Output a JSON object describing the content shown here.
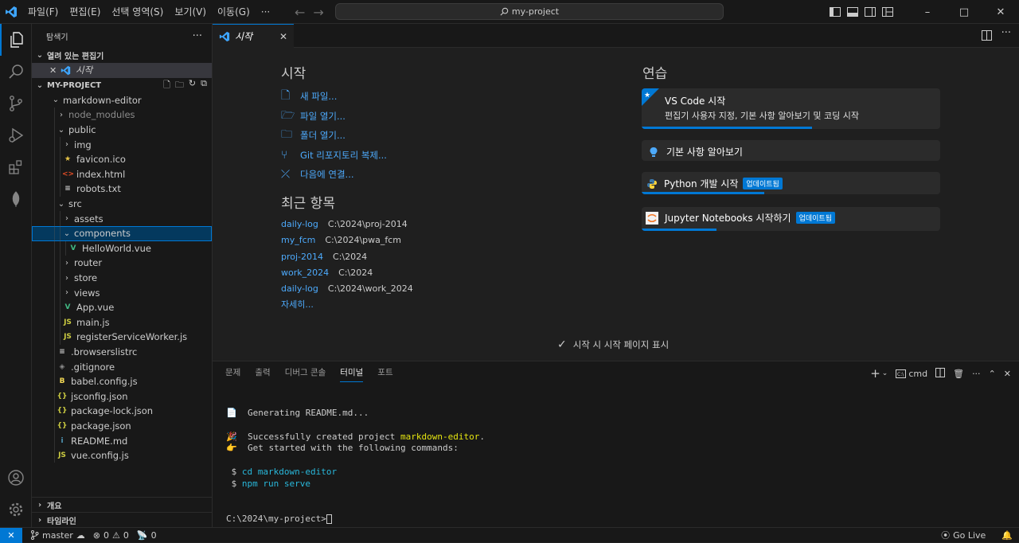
{
  "menu": [
    "파일(F)",
    "편집(E)",
    "선택 영역(S)",
    "보기(V)",
    "이동(G)",
    "···"
  ],
  "search": {
    "label": "my-project"
  },
  "explorer": {
    "title": "탐색기",
    "more": "···",
    "open_editors_label": "열려 있는 편집기",
    "open_editor_item": "시작",
    "project_label": "MY-PROJECT",
    "tree": [
      {
        "label": "markdown-editor",
        "depth": 0,
        "kind": "folder-open"
      },
      {
        "label": "node_modules",
        "depth": 1,
        "kind": "folder",
        "dim": true
      },
      {
        "label": "public",
        "depth": 1,
        "kind": "folder-open"
      },
      {
        "label": "img",
        "depth": 2,
        "kind": "folder"
      },
      {
        "label": "favicon.ico",
        "depth": 2,
        "kind": "star"
      },
      {
        "label": "index.html",
        "depth": 2,
        "kind": "html"
      },
      {
        "label": "robots.txt",
        "depth": 2,
        "kind": "txt"
      },
      {
        "label": "src",
        "depth": 1,
        "kind": "folder-open"
      },
      {
        "label": "assets",
        "depth": 2,
        "kind": "folder"
      },
      {
        "label": "components",
        "depth": 2,
        "kind": "folder-open",
        "selected": true
      },
      {
        "label": "HelloWorld.vue",
        "depth": 3,
        "kind": "vue"
      },
      {
        "label": "router",
        "depth": 2,
        "kind": "folder"
      },
      {
        "label": "store",
        "depth": 2,
        "kind": "folder"
      },
      {
        "label": "views",
        "depth": 2,
        "kind": "folder"
      },
      {
        "label": "App.vue",
        "depth": 2,
        "kind": "vue"
      },
      {
        "label": "main.js",
        "depth": 2,
        "kind": "js"
      },
      {
        "label": "registerServiceWorker.js",
        "depth": 2,
        "kind": "js"
      },
      {
        "label": ".browserslistrc",
        "depth": 1,
        "kind": "txt"
      },
      {
        "label": ".gitignore",
        "depth": 1,
        "kind": "git"
      },
      {
        "label": "babel.config.js",
        "depth": 1,
        "kind": "babel"
      },
      {
        "label": "jsconfig.json",
        "depth": 1,
        "kind": "json"
      },
      {
        "label": "package-lock.json",
        "depth": 1,
        "kind": "json"
      },
      {
        "label": "package.json",
        "depth": 1,
        "kind": "json"
      },
      {
        "label": "README.md",
        "depth": 1,
        "kind": "md"
      },
      {
        "label": "vue.config.js",
        "depth": 1,
        "kind": "js2"
      }
    ],
    "outline_label": "개요",
    "timeline_label": "타임라인"
  },
  "tab": {
    "label": "시작"
  },
  "welcome": {
    "start_heading": "시작",
    "start_links": [
      "새 파일...",
      "파일 열기...",
      "폴더 열기...",
      "Git 리포지토리 복제...",
      "다음에 연결..."
    ],
    "recent_heading": "최근 항목",
    "recent": [
      {
        "name": "daily-log",
        "path": "C:\\2024\\proj-2014"
      },
      {
        "name": "my_fcm",
        "path": "C:\\2024\\pwa_fcm"
      },
      {
        "name": "proj-2014",
        "path": "C:\\2024"
      },
      {
        "name": "work_2024",
        "path": "C:\\2024"
      },
      {
        "name": "daily-log",
        "path": "C:\\2024\\work_2024"
      }
    ],
    "more": "자세히...",
    "practice_heading": "연습",
    "walkthroughs": [
      {
        "title": "VS Code 시작",
        "desc": "편집기 사용자 지정, 기본 사항 알아보기 및 코딩 시작",
        "progress": 0.57
      },
      {
        "title": "기본 사항 알아보기"
      },
      {
        "title": "Python 개발 시작",
        "badge": "업데이트됨",
        "progress": 0.41
      },
      {
        "title": "Jupyter Notebooks 시작하기",
        "badge": "업데이트됨",
        "progress": 0.25
      }
    ],
    "show_on_startup": "시작 시 시작 페이지 표시"
  },
  "panel": {
    "tabs": [
      "문제",
      "출력",
      "디버그 콘솔",
      "터미널",
      "포트"
    ],
    "active_tab": "터미널",
    "shell": "cmd",
    "terminal": {
      "l1": "Generating README.md...",
      "l2a": "Successfully created project ",
      "l2b": "markdown-editor",
      "l2c": ".",
      "l3": "Get started with the following commands:",
      "c1a": "$ ",
      "c1b": "cd markdown-editor",
      "c2a": "$ ",
      "c2b": "npm run serve",
      "prompt": "C:\\2024\\my-project>"
    }
  },
  "status": {
    "branch": "master",
    "errors": "0",
    "warnings": "0",
    "ports": "0",
    "golive": "Go Live"
  },
  "colors": {
    "accent": "#0078d4",
    "link": "#4daafc",
    "bg": "#1f1f1f",
    "sidebar": "#181818"
  }
}
